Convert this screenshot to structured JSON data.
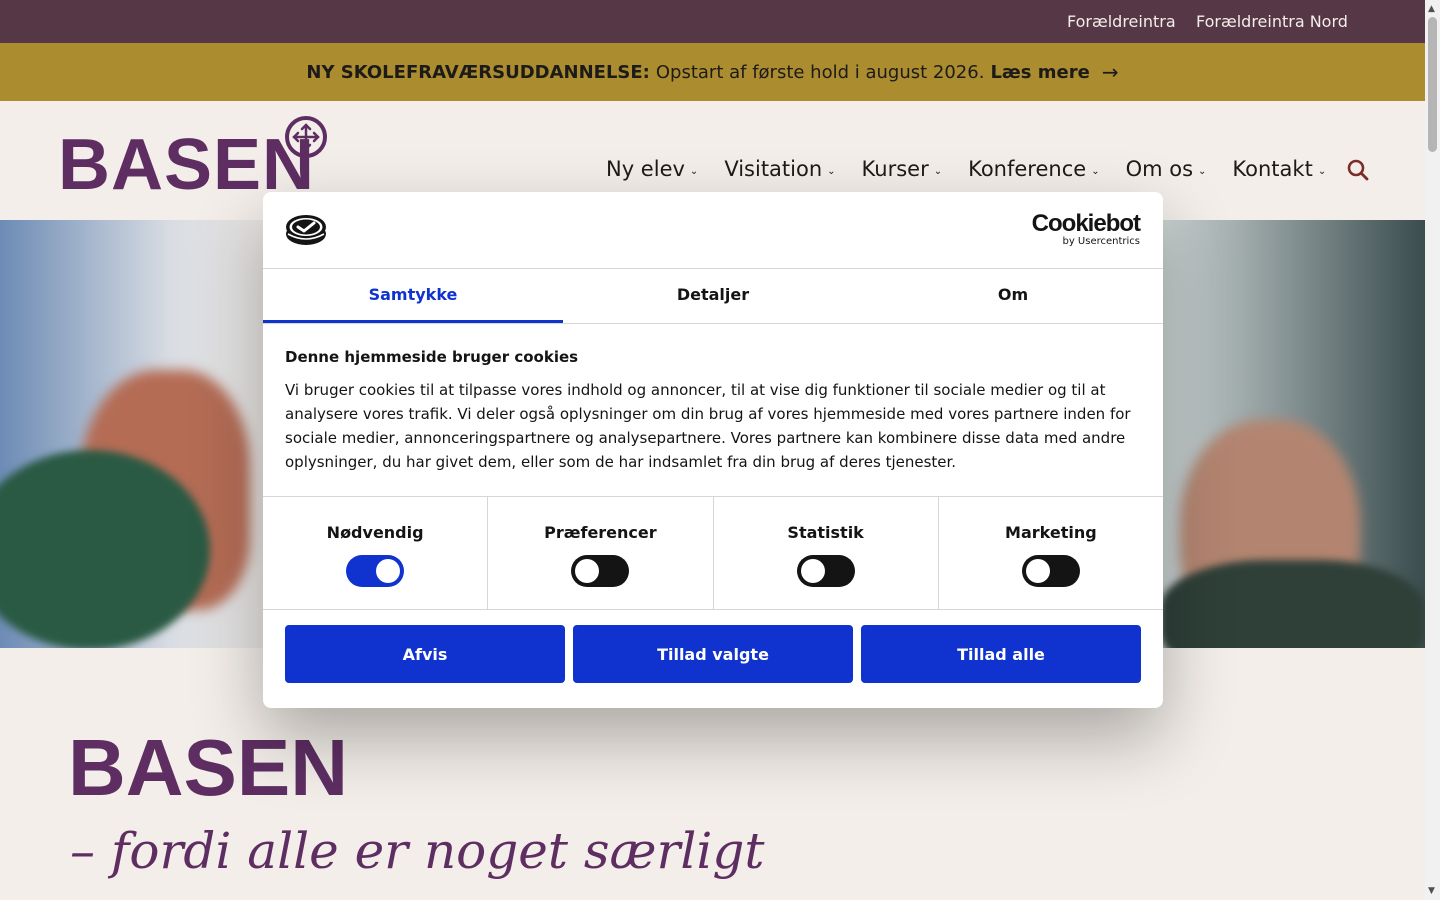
{
  "topbar": {
    "links": [
      "Forældreintra",
      "Forældreintra Nord"
    ]
  },
  "announcement": {
    "strong": "NY SKOLEFRAVÆRSUDDANNELSE:",
    "text": "Opstart af første hold i august 2026.",
    "more": "Læs mere",
    "arrow": "→"
  },
  "header": {
    "logo": "BASEN",
    "nav": [
      "Ny elev",
      "Visitation",
      "Kurser",
      "Konference",
      "Om os",
      "Kontakt"
    ],
    "chevron": "⌄",
    "search_icon": "search-icon"
  },
  "main": {
    "title": "BASEN",
    "tagline": "– fordi alle er noget særligt"
  },
  "cookie_dialog": {
    "brand": "Cookiebot",
    "brand_sub": "by Usercentrics",
    "tabs": [
      "Samtykke",
      "Detaljer",
      "Om"
    ],
    "active_tab": "Samtykke",
    "heading": "Denne hjemmeside bruger cookies",
    "text": "Vi bruger cookies til at tilpasse vores indhold og annoncer, til at vise dig funktioner til sociale medier og til at analysere vores trafik. Vi deler også oplysninger om din brug af vores hjemmeside med vores partnere inden for sociale medier, annonceringspartnere og analysepartnere. Vores partnere kan kombinere disse data med andre oplysninger, du har givet dem, eller som de har indsamlet fra din brug af deres tjenester.",
    "categories": [
      {
        "label": "Nødvendig",
        "on": true
      },
      {
        "label": "Præferencer",
        "on": false
      },
      {
        "label": "Statistik",
        "on": false
      },
      {
        "label": "Marketing",
        "on": false
      }
    ],
    "buttons": [
      "Afvis",
      "Tillad valgte",
      "Tillad alle"
    ]
  },
  "colors": {
    "brand_purple": "#5e2e63",
    "topbar": "#563745",
    "announce": "#ab8c2f",
    "cookie_blue": "#1032cf"
  }
}
